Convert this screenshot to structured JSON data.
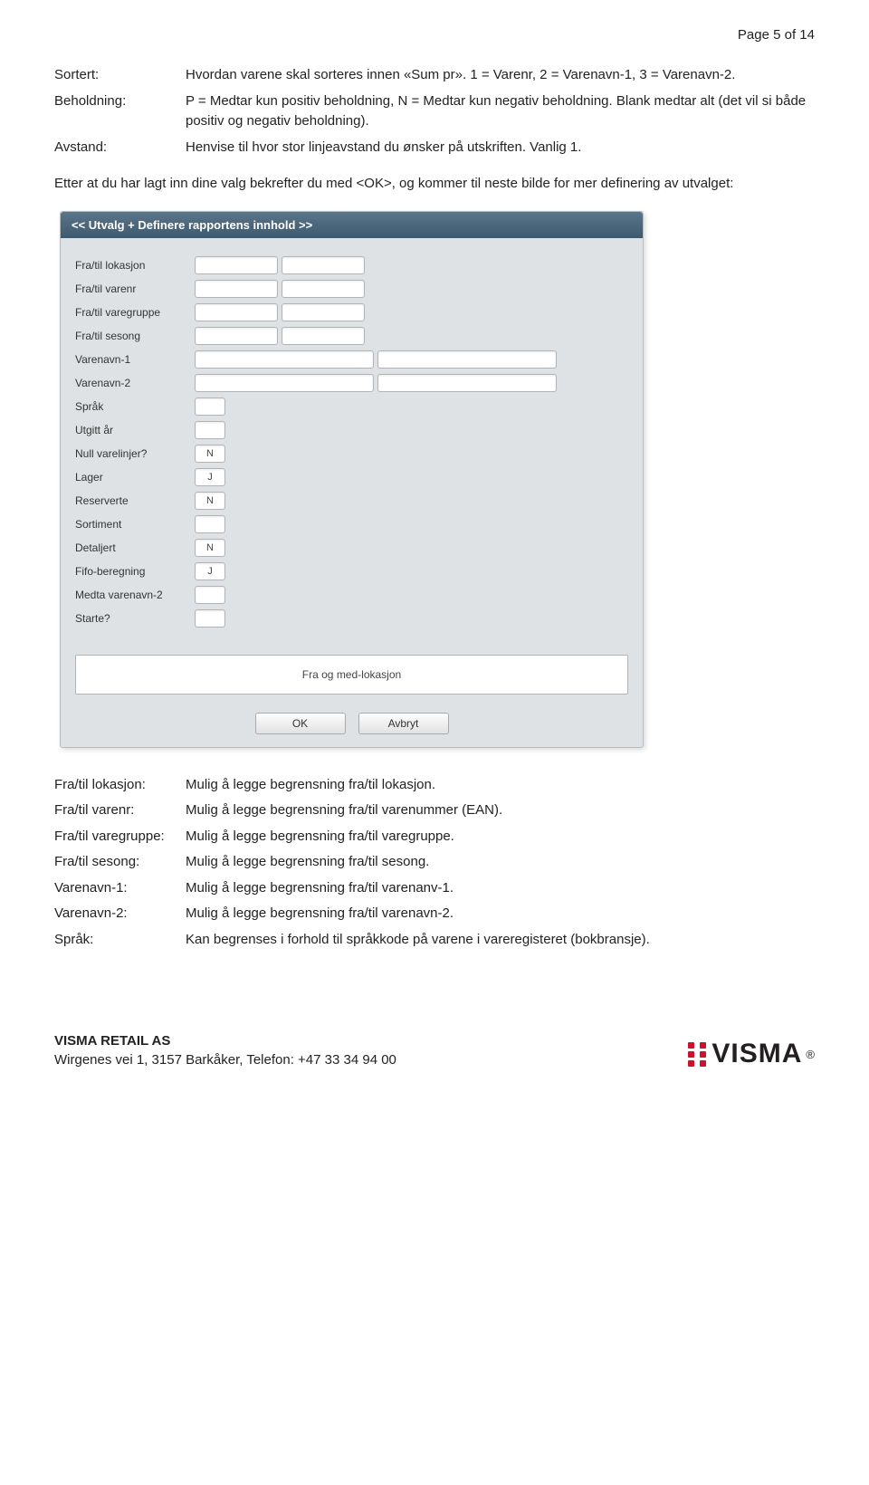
{
  "page_header": "Page 5 of 14",
  "top_defs": [
    {
      "label": "Sortert:",
      "desc": "Hvordan varene skal sorteres innen «Sum pr». 1 = Varenr, 2 = Varenavn-1, 3 = Varenavn-2."
    },
    {
      "label": "Beholdning:",
      "desc": "P = Medtar kun positiv beholdning, N = Medtar kun negativ beholdning. Blank medtar alt (det vil si både positiv og negativ beholdning)."
    },
    {
      "label": "Avstand:",
      "desc": "Henvise til hvor stor linjeavstand du ønsker på utskriften. Vanlig 1."
    }
  ],
  "mid_paragraph": "Etter at du har lagt inn dine valg bekrefter du med <OK>, og kommer til neste bilde for mer definering av utvalget:",
  "panel": {
    "title": "<< Utvalg + Definere rapportens innhold >>",
    "fields": [
      {
        "label": "Fra/til lokasjon",
        "type": "range-sm"
      },
      {
        "label": "Fra/til varenr",
        "type": "range-sm"
      },
      {
        "label": "Fra/til varegruppe",
        "type": "range-sm"
      },
      {
        "label": "Fra/til sesong",
        "type": "range-sm"
      },
      {
        "label": "Varenavn-1",
        "type": "range-med"
      },
      {
        "label": "Varenavn-2",
        "type": "range-med"
      },
      {
        "label": "Språk",
        "type": "tiny"
      },
      {
        "label": "Utgitt år",
        "type": "tiny"
      },
      {
        "label": "Null varelinjer?",
        "type": "val",
        "value": "N"
      },
      {
        "label": "Lager",
        "type": "val",
        "value": "J"
      },
      {
        "label": "Reserverte",
        "type": "val",
        "value": "N"
      },
      {
        "label": "Sortiment",
        "type": "tiny"
      },
      {
        "label": "Detaljert",
        "type": "val",
        "value": "N"
      },
      {
        "label": "Fifo-beregning",
        "type": "val",
        "value": "J"
      },
      {
        "label": "Medta varenavn-2",
        "type": "tiny"
      },
      {
        "label": "Starte?",
        "type": "tiny"
      }
    ],
    "status": "Fra og med-lokasjon",
    "buttons": {
      "ok": "OK",
      "cancel": "Avbryt"
    }
  },
  "bottom_defs": [
    {
      "label": "Fra/til lokasjon:",
      "desc": "Mulig å legge begrensning fra/til lokasjon."
    },
    {
      "label": "Fra/til varenr:",
      "desc": "Mulig å legge begrensning fra/til varenummer (EAN)."
    },
    {
      "label": "Fra/til varegruppe:",
      "desc": "Mulig å legge begrensning fra/til varegruppe."
    },
    {
      "label": "Fra/til sesong:",
      "desc": "Mulig å legge begrensning fra/til sesong."
    },
    {
      "label": "Varenavn-1:",
      "desc": "Mulig å legge begrensning fra/til varenanv-1."
    },
    {
      "label": "Varenavn-2:",
      "desc": "Mulig å legge begrensning fra/til varenavn-2."
    },
    {
      "label": "Språk:",
      "desc": "Kan begrenses i forhold til språkkode på varene i vareregisteret (bokbransje)."
    }
  ],
  "footer": {
    "company": "VISMA RETAIL AS",
    "address": "Wirgenes vei 1, 3157 Barkåker, Telefon: +47 33 34 94 00",
    "logo_text": "VISMA"
  }
}
